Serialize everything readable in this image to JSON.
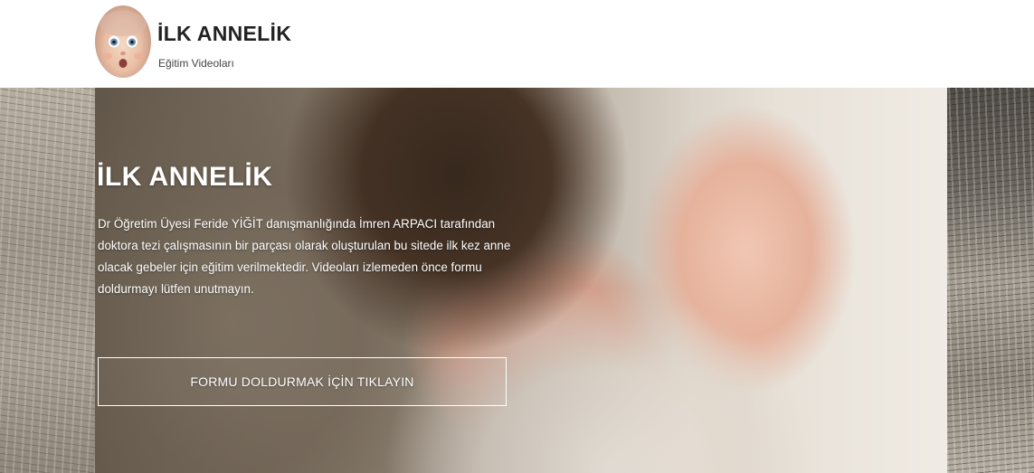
{
  "header": {
    "logo_icon": "baby-face-icon",
    "title": "İLK ANNELİK",
    "subtitle": "Eğitim Videoları"
  },
  "hero": {
    "title": "İLK ANNELİK",
    "description": "Dr Öğretim Üyesi Feride YİĞİT danışmanlığında İmren ARPACI tarafından doktora tezi çalışmasının bir parçası olarak oluşturulan bu sitede ilk kez anne olacak gebeler için eğitim verilmektedir. Videoları izlemeden önce formu doldurmayı lütfen unutmayın.",
    "cta_label": "FORMU DOLDURMAK İÇİN TIKLAYIN"
  },
  "colors": {
    "text_on_hero": "#ffffff",
    "header_title": "#222222"
  }
}
